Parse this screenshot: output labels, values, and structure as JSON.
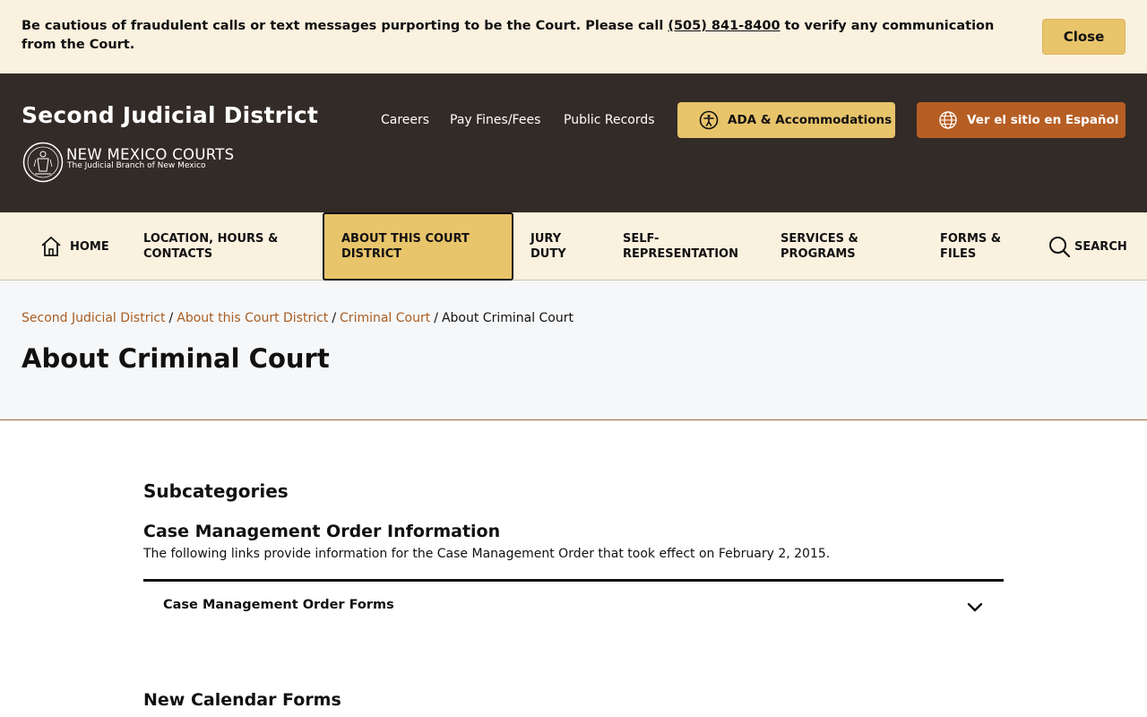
{
  "alert": {
    "text_before": "Be cautious of fraudulent calls or text messages purporting to be the Court. Please call ",
    "phone": "(505) 841-8400",
    "text_after": " to verify any communication from the Court.",
    "close_label": "Close"
  },
  "header": {
    "site_title": "Second Judicial District",
    "brand_main": "NEW MEXICO COURTS",
    "brand_sub": "The Judicial Branch of New Mexico",
    "utility_links": [
      "Careers",
      "Pay Fines/Fees",
      "Public Records"
    ],
    "ada_label": "ADA & Accommodations",
    "ada_icon": "accessibility-icon",
    "spanish_label": "Ver el sitio en Español",
    "spanish_icon": "globe-icon",
    "ada_color": "#e8c46b",
    "spanish_color": "#b65e24",
    "bg_color": "#332b27"
  },
  "nav": {
    "home": "HOME",
    "items": [
      {
        "line1": "LOCATION, HOURS &",
        "line2": "CONTACTS"
      },
      {
        "line1": "ABOUT THIS COURT",
        "line2": "DISTRICT",
        "active": true
      },
      {
        "line1": "JURY",
        "line2": "DUTY"
      },
      {
        "line1": "SELF-",
        "line2": "REPRESENTATION"
      },
      {
        "line1": "SERVICES &",
        "line2": "PROGRAMS"
      },
      {
        "line1": "FORMS &",
        "line2": "FILES"
      }
    ],
    "search": "SEARCH"
  },
  "breadcrumb": {
    "items": [
      "Second Judicial District",
      "About this Court District",
      "Criminal Court"
    ],
    "current": "About Criminal Court"
  },
  "page": {
    "title": "About Criminal Court"
  },
  "content": {
    "subcategories_heading": "Subcategories",
    "cmo_heading": "Case Management Order Information",
    "cmo_description": "The following links provide information for the Case Management Order that took effect on February 2, 2015.",
    "accordion_label": "Case Management Order Forms",
    "new_calendar_heading": "New Calendar Forms"
  }
}
